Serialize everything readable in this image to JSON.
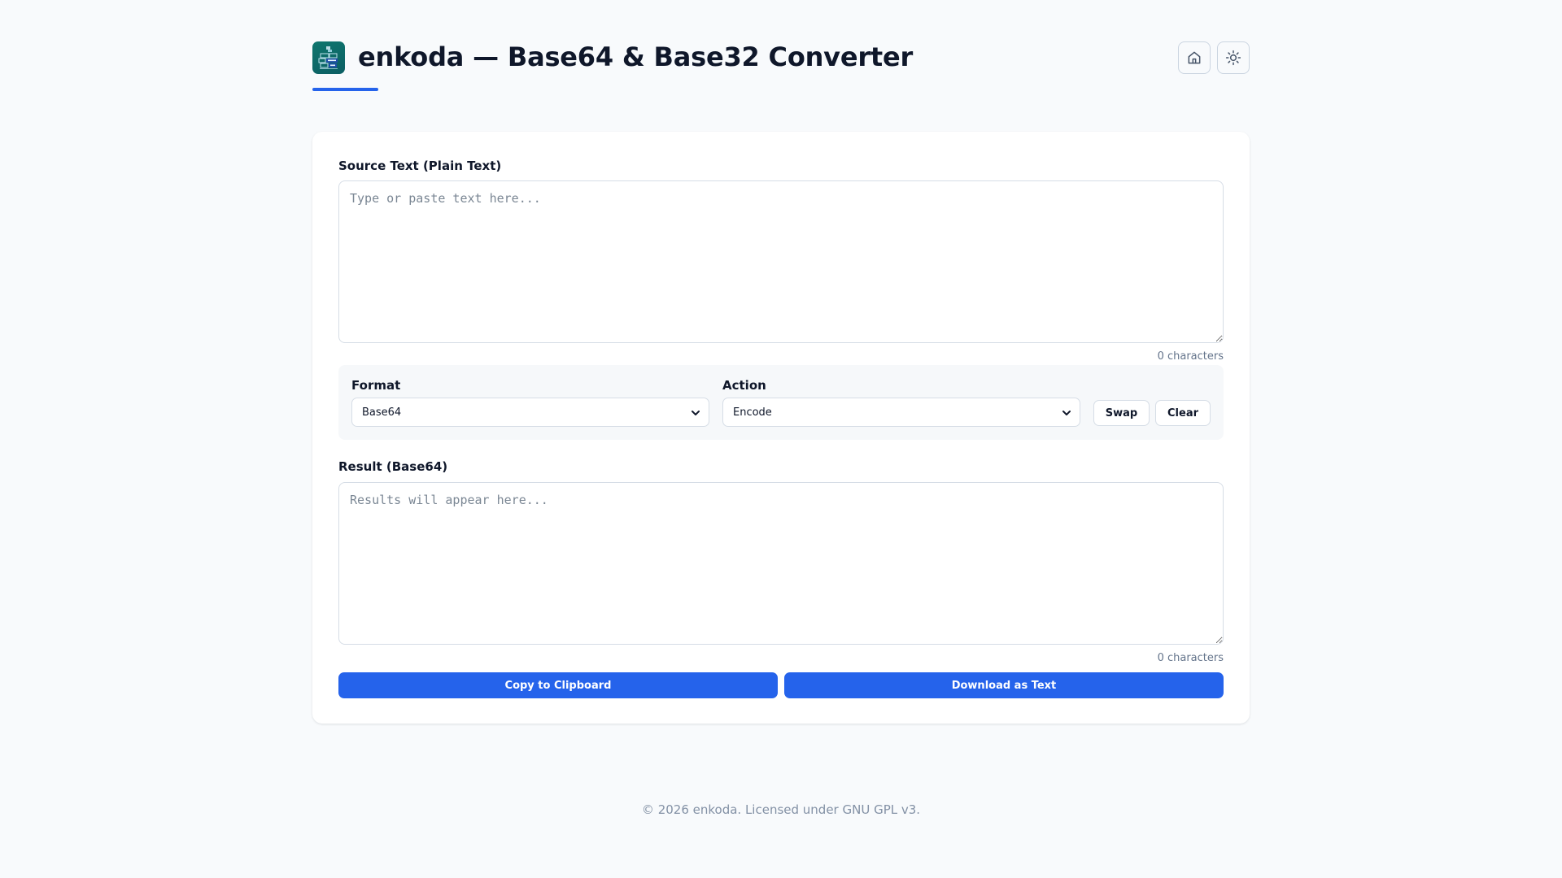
{
  "header": {
    "title": "enkoda — Base64 & Base32 Converter",
    "logo_icon": "binary-blocks-icon",
    "home_icon": "home-icon",
    "theme_icon": "sun-icon",
    "accent_color": "#2563eb"
  },
  "source": {
    "label": "Source Text (Plain Text)",
    "placeholder": "Type or paste text here...",
    "value": "",
    "count": "0 characters"
  },
  "controls": {
    "format_label": "Format",
    "format_value": "Base64",
    "action_label": "Action",
    "action_value": "Encode",
    "swap_label": "Swap",
    "clear_label": "Clear"
  },
  "result": {
    "label": "Result (Base64)",
    "placeholder": "Results will appear here...",
    "value": "",
    "count": "0 characters"
  },
  "actions": {
    "copy_label": "Copy to Clipboard",
    "download_label": "Download as Text"
  },
  "footer": {
    "text": "© 2026 enkoda. Licensed under GNU GPL v3."
  }
}
